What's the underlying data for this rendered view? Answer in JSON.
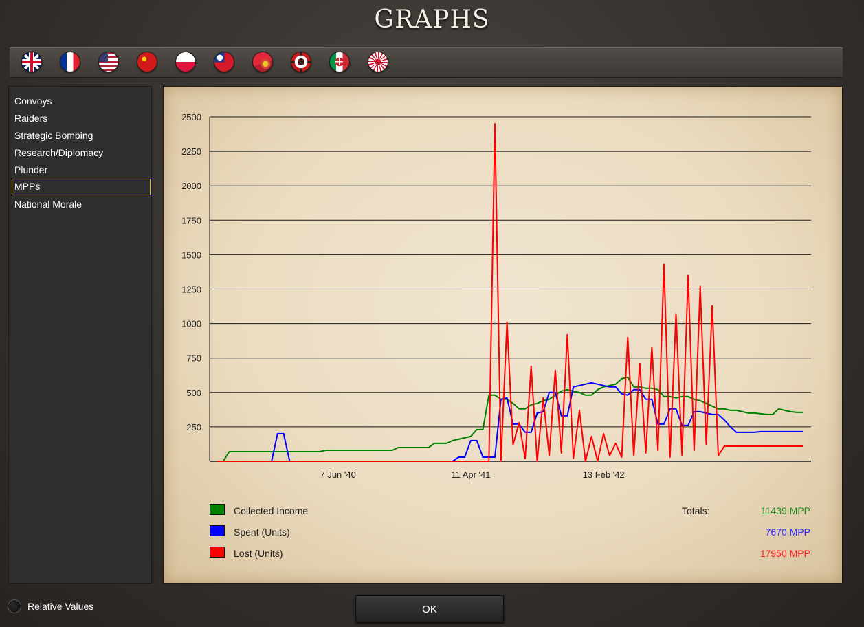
{
  "title": "GRAPHS",
  "flags": [
    {
      "icon": "uk-flag-icon",
      "selected": false
    },
    {
      "icon": "france-flag-icon",
      "selected": false
    },
    {
      "icon": "usa-flag-icon",
      "selected": false
    },
    {
      "icon": "ussr-flag-icon",
      "selected": true
    },
    {
      "icon": "poland-flag-icon",
      "selected": false
    },
    {
      "icon": "china-flag-icon",
      "selected": false
    },
    {
      "icon": "fascist-flag-icon",
      "selected": false
    },
    {
      "icon": "germany-flag-icon",
      "selected": false
    },
    {
      "icon": "italy-flag-icon",
      "selected": false
    },
    {
      "icon": "japan-flag-icon",
      "selected": false
    }
  ],
  "sidebar": {
    "items": [
      {
        "label": "Convoys"
      },
      {
        "label": "Raiders"
      },
      {
        "label": "Strategic Bombing"
      },
      {
        "label": "Research/Diplomacy"
      },
      {
        "label": "Plunder"
      },
      {
        "label": "MPPs",
        "selected": true
      },
      {
        "label": "National Morale"
      }
    ]
  },
  "legend": [
    {
      "label": "Collected Income",
      "color": "#008000"
    },
    {
      "label": "Spent (Units)",
      "color": "#0000ff"
    },
    {
      "label": "Lost (Units)",
      "color": "#ff0000"
    }
  ],
  "totals": {
    "label": "Totals:",
    "values": [
      {
        "text": "11439 MPP",
        "color": "#1e8c1e"
      },
      {
        "text": "7670 MPP",
        "color": "#2a2aff"
      },
      {
        "text": "17950 MPP",
        "color": "#ff2222"
      }
    ]
  },
  "relative_values_label": "Relative Values",
  "ok_label": "OK",
  "chart_data": {
    "type": "line",
    "ylim": [
      0,
      2500
    ],
    "yticks": [
      250,
      500,
      750,
      1000,
      1250,
      1500,
      1750,
      2000,
      2250,
      2500
    ],
    "x_tick_labels": [
      {
        "label": "7 Jun '40",
        "index": 20
      },
      {
        "label": "11 Apr '41",
        "index": 42
      },
      {
        "label": "13 Feb '42",
        "index": 64
      }
    ],
    "series": [
      {
        "name": "Collected Income",
        "color": "#008000",
        "values": [
          0,
          0,
          70,
          70,
          70,
          70,
          70,
          70,
          70,
          70,
          70,
          70,
          70,
          70,
          70,
          70,
          70,
          70,
          80,
          80,
          80,
          80,
          80,
          80,
          80,
          80,
          80,
          80,
          80,
          80,
          100,
          100,
          100,
          100,
          100,
          100,
          130,
          130,
          130,
          150,
          160,
          170,
          180,
          230,
          230,
          480,
          480,
          450,
          450,
          420,
          380,
          380,
          410,
          420,
          440,
          450,
          480,
          510,
          520,
          510,
          500,
          480,
          480,
          520,
          540,
          550,
          560,
          600,
          610,
          540,
          540,
          530,
          530,
          520,
          470,
          470,
          460,
          470,
          470,
          450,
          440,
          420,
          400,
          380,
          380,
          370,
          370,
          360,
          350,
          350,
          345,
          340,
          340,
          380,
          370,
          360,
          355,
          355
        ]
      },
      {
        "name": "Spent (Units)",
        "color": "#0000ff",
        "values": [
          0,
          0,
          0,
          0,
          0,
          0,
          0,
          0,
          0,
          0,
          200,
          200,
          0,
          0,
          0,
          0,
          0,
          0,
          0,
          0,
          0,
          0,
          0,
          0,
          0,
          0,
          0,
          0,
          0,
          0,
          0,
          0,
          0,
          0,
          0,
          0,
          0,
          0,
          0,
          0,
          30,
          30,
          150,
          150,
          30,
          30,
          30,
          450,
          460,
          270,
          270,
          210,
          210,
          350,
          360,
          500,
          500,
          330,
          330,
          540,
          550,
          560,
          570,
          560,
          550,
          540,
          540,
          490,
          480,
          520,
          520,
          450,
          450,
          270,
          270,
          380,
          380,
          260,
          260,
          360,
          360,
          350,
          340,
          340,
          300,
          250,
          210,
          210,
          210,
          210,
          215,
          215,
          215,
          215,
          215,
          215,
          215,
          215
        ]
      },
      {
        "name": "Lost (Units)",
        "color": "#ff0000",
        "values": [
          0,
          0,
          0,
          0,
          0,
          0,
          0,
          0,
          0,
          0,
          0,
          0,
          0,
          0,
          0,
          0,
          0,
          0,
          0,
          0,
          0,
          0,
          0,
          0,
          0,
          0,
          0,
          0,
          0,
          0,
          0,
          0,
          0,
          0,
          0,
          0,
          0,
          0,
          0,
          0,
          0,
          0,
          0,
          0,
          0,
          0,
          2450,
          0,
          1010,
          120,
          280,
          20,
          690,
          0,
          460,
          40,
          660,
          60,
          920,
          20,
          370,
          0,
          180,
          0,
          200,
          40,
          130,
          30,
          900,
          40,
          710,
          60,
          830,
          80,
          1430,
          30,
          1070,
          40,
          1350,
          80,
          1270,
          120,
          1130,
          40,
          110,
          110,
          110,
          110,
          110,
          110,
          110,
          110,
          110,
          110,
          110,
          110,
          110,
          110
        ]
      }
    ]
  }
}
